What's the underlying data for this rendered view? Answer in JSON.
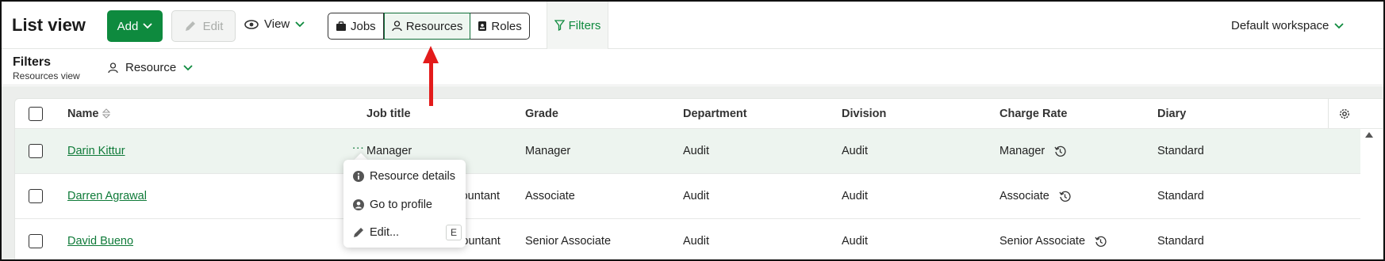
{
  "toolbar": {
    "app_title": "List view",
    "add_label": "Add",
    "edit_label": "Edit",
    "view_label": "View",
    "segments": [
      {
        "label": "Jobs",
        "icon": "briefcase-icon",
        "active": false
      },
      {
        "label": "Resources",
        "icon": "person-icon",
        "active": true
      },
      {
        "label": "Roles",
        "icon": "badge-icon",
        "active": false
      }
    ],
    "filters_label": "Filters",
    "workspace_label": "Default workspace"
  },
  "filterbar": {
    "title": "Filters",
    "subtitle": "Resources view",
    "resource_label": "Resource"
  },
  "table": {
    "columns": [
      "Name",
      "Job title",
      "Grade",
      "Department",
      "Division",
      "Charge Rate",
      "Diary"
    ],
    "rows": [
      {
        "name": "Darin Kittur",
        "job_title": "Manager",
        "grade": "Manager",
        "department": "Audit",
        "division": "Audit",
        "charge_rate": "Manager",
        "diary": "Standard"
      },
      {
        "name": "Darren Agrawal",
        "job_title": "t accountant",
        "grade": "Associate",
        "department": "Audit",
        "division": "Audit",
        "charge_rate": "Associate",
        "diary": "Standard"
      },
      {
        "name": "David Bueno",
        "job_title": "t Accountant",
        "grade": "Senior Associate",
        "department": "Audit",
        "division": "Audit",
        "charge_rate": "Senior Associate",
        "diary": "Standard"
      }
    ],
    "row_menu_label": "..."
  },
  "context_menu": {
    "items": [
      {
        "label": "Resource details",
        "icon": "info-icon"
      },
      {
        "label": "Go to profile",
        "icon": "user-circle-icon"
      },
      {
        "label": "Edit...",
        "icon": "pencil-icon",
        "shortcut": "E"
      }
    ]
  },
  "colors": {
    "accent": "#0e8a3e",
    "link": "#0e7a38",
    "annotation_arrow": "#e31b1b",
    "selected_row": "#edf4ef"
  }
}
